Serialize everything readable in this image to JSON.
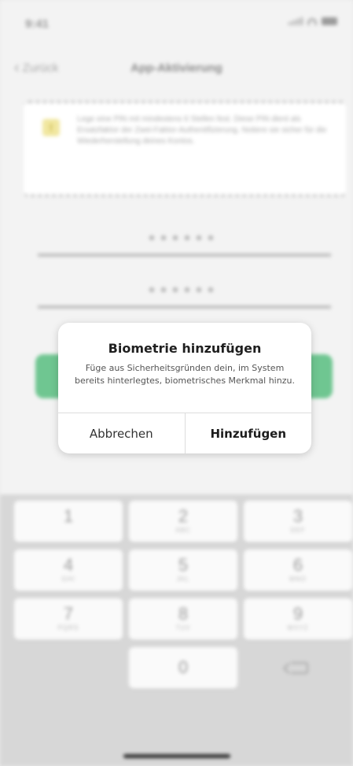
{
  "status_bar": {
    "time": "9:41"
  },
  "nav": {
    "back_label": "Zurück",
    "title": "App-Aktivierung"
  },
  "info_box": {
    "icon": "warning-icon",
    "text": "Lege eine PIN mit mindestens 6 Stellen fest. Diese PIN dient als Ersatzfaktor der Zwei-Faktor-Authentifizierung. Notiere sie sicher für die Wiederherstellung deines Kontos."
  },
  "form": {
    "pin_masked": "••••••",
    "pin_confirm_masked": "••••••",
    "accent_color": "#6fc691"
  },
  "dialog": {
    "title": "Biometrie hinzufügen",
    "message": "Füge aus Sicherheitsgründen dein, im System bereits hinterlegtes, biometrisches Merkmal hinzu.",
    "cancel_label": "Abbrechen",
    "confirm_label": "Hinzufügen"
  },
  "keypad": {
    "keys": [
      {
        "digit": "1",
        "letters": ""
      },
      {
        "digit": "2",
        "letters": "ABC"
      },
      {
        "digit": "3",
        "letters": "DEF"
      },
      {
        "digit": "4",
        "letters": "GHI"
      },
      {
        "digit": "5",
        "letters": "JKL"
      },
      {
        "digit": "6",
        "letters": "MNO"
      },
      {
        "digit": "7",
        "letters": "PQRS"
      },
      {
        "digit": "8",
        "letters": "TUV"
      },
      {
        "digit": "9",
        "letters": "WXYZ"
      },
      {
        "digit": "0",
        "letters": ""
      }
    ],
    "backspace_icon": "backspace-icon"
  }
}
